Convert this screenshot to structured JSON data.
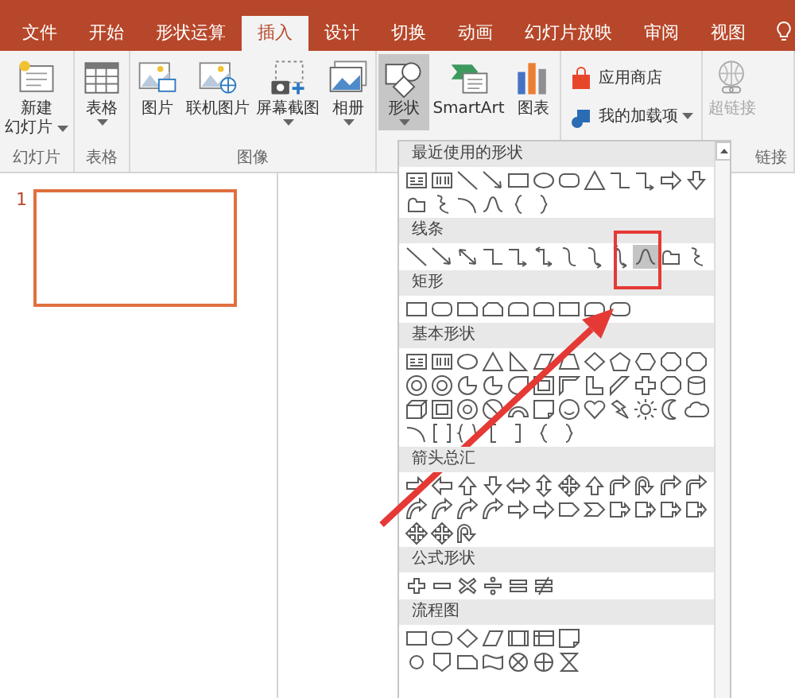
{
  "tabs": [
    {
      "label": "文件",
      "selected": false
    },
    {
      "label": "开始",
      "selected": false
    },
    {
      "label": "形状运算",
      "selected": false
    },
    {
      "label": "插入",
      "selected": true
    },
    {
      "label": "设计",
      "selected": false
    },
    {
      "label": "切换",
      "selected": false
    },
    {
      "label": "动画",
      "selected": false
    },
    {
      "label": "幻灯片放映",
      "selected": false
    },
    {
      "label": "审阅",
      "selected": false
    },
    {
      "label": "视图",
      "selected": false
    }
  ],
  "ribbon": {
    "groups": [
      {
        "label": "幻灯片",
        "buttons": [
          {
            "kind": "large",
            "lines": [
              "新建",
              "幻灯片"
            ],
            "dropdown": true,
            "pressed": false,
            "disabled": false
          }
        ]
      },
      {
        "label": "表格",
        "buttons": [
          {
            "kind": "large",
            "lines": [
              "表格"
            ],
            "dropdown": true,
            "pressed": false,
            "disabled": false
          }
        ]
      },
      {
        "label": "图像",
        "buttons": [
          {
            "kind": "large",
            "lines": [
              "图片"
            ],
            "dropdown": false,
            "pressed": false,
            "disabled": false
          },
          {
            "kind": "large",
            "lines": [
              "联机图片"
            ],
            "dropdown": false,
            "pressed": false,
            "disabled": false
          },
          {
            "kind": "large",
            "lines": [
              "屏幕截图"
            ],
            "dropdown": true,
            "pressed": false,
            "disabled": false
          },
          {
            "kind": "large",
            "lines": [
              "相册"
            ],
            "dropdown": true,
            "pressed": false,
            "disabled": false
          }
        ]
      },
      {
        "buttons": [
          {
            "kind": "large",
            "lines": [
              "形状"
            ],
            "dropdown": true,
            "pressed": true,
            "disabled": false
          },
          {
            "kind": "large",
            "lines": [
              "SmartArt"
            ],
            "dropdown": false,
            "pressed": false,
            "disabled": false
          },
          {
            "kind": "large",
            "lines": [
              "图表"
            ],
            "dropdown": false,
            "pressed": false,
            "disabled": false
          }
        ]
      },
      {
        "buttons": [
          {
            "kind": "small",
            "lines": [
              "应用商店"
            ],
            "dropdown": false
          },
          {
            "kind": "small",
            "lines": [
              "我的加载项"
            ],
            "dropdown": true
          }
        ]
      },
      {
        "label": "链接",
        "buttons": [
          {
            "kind": "large",
            "lines": [
              "超链接"
            ],
            "dropdown": false,
            "pressed": false,
            "disabled": true
          }
        ]
      }
    ]
  },
  "slides": [
    {
      "number": "1",
      "selected": true
    }
  ],
  "shapes_gallery": {
    "sections": [
      {
        "title": "最近使用的形状",
        "rows": [
          [
            {
              "kind": "textbox",
              "selected": false
            },
            {
              "kind": "vtextbox",
              "selected": false
            },
            {
              "kind": "line",
              "selected": false
            },
            {
              "kind": "arrowline",
              "selected": false
            },
            {
              "kind": "rect",
              "selected": false
            },
            {
              "kind": "oval",
              "selected": false
            },
            {
              "kind": "roundrect",
              "selected": false
            },
            {
              "kind": "triangle",
              "selected": false
            },
            {
              "kind": "elbow",
              "selected": false
            },
            {
              "kind": "elbowarrow",
              "selected": false
            },
            {
              "kind": "rarrow",
              "selected": false
            },
            {
              "kind": "darrow",
              "selected": false
            }
          ],
          [
            {
              "kind": "freeform",
              "selected": false
            },
            {
              "kind": "scribble",
              "selected": false
            },
            {
              "kind": "arc",
              "selected": false
            },
            {
              "kind": "curve",
              "selected": false
            },
            {
              "kind": "lbrace",
              "selected": false
            },
            {
              "kind": "rbrace",
              "selected": false
            }
          ]
        ]
      },
      {
        "title": "线条",
        "rows": [
          [
            {
              "kind": "line",
              "selected": false
            },
            {
              "kind": "arrowline",
              "selected": false
            },
            {
              "kind": "dblarrow",
              "selected": false
            },
            {
              "kind": "elbow",
              "selected": false
            },
            {
              "kind": "elbowarrow",
              "selected": false
            },
            {
              "kind": "elbowdbl",
              "selected": false
            },
            {
              "kind": "curveconn",
              "selected": false
            },
            {
              "kind": "curvearrow",
              "selected": false
            },
            {
              "kind": "curvedbl",
              "selected": false
            },
            {
              "kind": "curve",
              "selected": true
            },
            {
              "kind": "freeform",
              "selected": false
            },
            {
              "kind": "scribble",
              "selected": false
            }
          ]
        ]
      },
      {
        "title": "矩形",
        "rows": [
          [
            {
              "kind": "rect",
              "selected": false
            },
            {
              "kind": "roundrect",
              "selected": false
            },
            {
              "kind": "snip",
              "selected": false
            },
            {
              "kind": "snip2",
              "selected": false
            },
            {
              "kind": "roundtop",
              "selected": false
            },
            {
              "kind": "roundtop",
              "selected": false
            },
            {
              "kind": "rect",
              "selected": false
            },
            {
              "kind": "roundtop",
              "selected": false
            },
            {
              "kind": "roundrect",
              "selected": false
            }
          ]
        ]
      },
      {
        "title": "基本形状",
        "rows": [
          [
            {
              "kind": "textbox",
              "selected": false
            },
            {
              "kind": "vtextbox",
              "selected": false
            },
            {
              "kind": "oval",
              "selected": false
            },
            {
              "kind": "triangle",
              "selected": false
            },
            {
              "kind": "rtriangle",
              "selected": false
            },
            {
              "kind": "parallelogram",
              "selected": false
            },
            {
              "kind": "trapezoid",
              "selected": false
            },
            {
              "kind": "diamond",
              "selected": false
            },
            {
              "kind": "pentagon",
              "selected": false
            },
            {
              "kind": "hexagon",
              "selected": false
            },
            {
              "kind": "octagon",
              "selected": false
            },
            {
              "kind": "octagon",
              "selected": false
            }
          ],
          [
            {
              "kind": "target",
              "selected": false
            },
            {
              "kind": "target",
              "selected": false
            },
            {
              "kind": "pie",
              "selected": false
            },
            {
              "kind": "pie",
              "selected": false
            },
            {
              "kind": "teardrop",
              "selected": false
            },
            {
              "kind": "frame",
              "selected": false
            },
            {
              "kind": "halfframe",
              "selected": false
            },
            {
              "kind": "lshape",
              "selected": false
            },
            {
              "kind": "stripe",
              "selected": false
            },
            {
              "kind": "cross",
              "selected": false
            },
            {
              "kind": "octagon",
              "selected": false
            },
            {
              "kind": "can",
              "selected": false
            }
          ],
          [
            {
              "kind": "cube",
              "selected": false
            },
            {
              "kind": "frame",
              "selected": false
            },
            {
              "kind": "donut",
              "selected": false
            },
            {
              "kind": "nosymbol",
              "selected": false
            },
            {
              "kind": "blockarc",
              "selected": false
            },
            {
              "kind": "document",
              "selected": false
            },
            {
              "kind": "smiley",
              "selected": false
            },
            {
              "kind": "heart",
              "selected": false
            },
            {
              "kind": "bolt",
              "selected": false
            },
            {
              "kind": "sun",
              "selected": false
            },
            {
              "kind": "moon",
              "selected": false
            },
            {
              "kind": "cloud",
              "selected": false
            }
          ],
          [
            {
              "kind": "arc",
              "selected": false
            },
            {
              "kind": "bracketpair",
              "selected": false
            },
            {
              "kind": "bracepair",
              "selected": false
            },
            {
              "kind": "lbracket",
              "selected": false
            },
            {
              "kind": "rbracket",
              "selected": false
            },
            {
              "kind": "lbrace",
              "selected": false
            },
            {
              "kind": "rbrace",
              "selected": false
            }
          ]
        ]
      },
      {
        "title": "箭头总汇",
        "rows": [
          [
            {
              "kind": "rarrow",
              "selected": false
            },
            {
              "kind": "larrow",
              "selected": false
            },
            {
              "kind": "uarrow",
              "selected": false
            },
            {
              "kind": "darrow",
              "selected": false
            },
            {
              "kind": "lrarrow",
              "selected": false
            },
            {
              "kind": "udarrow",
              "selected": false
            },
            {
              "kind": "quadarrow",
              "selected": false
            },
            {
              "kind": "uarrow",
              "selected": false
            },
            {
              "kind": "bentarrow",
              "selected": false
            },
            {
              "kind": "uturn",
              "selected": false
            },
            {
              "kind": "bentarrow",
              "selected": false
            },
            {
              "kind": "bentarrow",
              "selected": false
            }
          ],
          [
            {
              "kind": "curvedarrow",
              "selected": false
            },
            {
              "kind": "curvedarrow",
              "selected": false
            },
            {
              "kind": "curvedarrow",
              "selected": false
            },
            {
              "kind": "curvedarrow",
              "selected": false
            },
            {
              "kind": "rarrow",
              "selected": false
            },
            {
              "kind": "rarrow",
              "selected": false
            },
            {
              "kind": "homeplate",
              "selected": false
            },
            {
              "kind": "chevron",
              "selected": false
            },
            {
              "kind": "callout",
              "selected": false
            },
            {
              "kind": "callout",
              "selected": false
            },
            {
              "kind": "callout",
              "selected": false
            },
            {
              "kind": "callout",
              "selected": false
            }
          ],
          [
            {
              "kind": "quadarrow",
              "selected": false
            },
            {
              "kind": "quadarrow",
              "selected": false
            },
            {
              "kind": "uturn",
              "selected": false
            }
          ]
        ]
      },
      {
        "title": "公式形状",
        "rows": [
          [
            {
              "kind": "plus",
              "selected": false
            },
            {
              "kind": "minus",
              "selected": false
            },
            {
              "kind": "times",
              "selected": false
            },
            {
              "kind": "divide",
              "selected": false
            },
            {
              "kind": "equal",
              "selected": false
            },
            {
              "kind": "notequal",
              "selected": false
            }
          ]
        ]
      },
      {
        "title": "流程图",
        "rows": [
          [
            {
              "kind": "rect",
              "selected": false
            },
            {
              "kind": "roundrect",
              "selected": false
            },
            {
              "kind": "diamond",
              "selected": false
            },
            {
              "kind": "parallelogram",
              "selected": false
            },
            {
              "kind": "predefined",
              "selected": false
            },
            {
              "kind": "internal",
              "selected": false
            },
            {
              "kind": "document",
              "selected": false
            }
          ],
          [
            {
              "kind": "smallcircle",
              "selected": false
            },
            {
              "kind": "offpage",
              "selected": false
            },
            {
              "kind": "snip",
              "selected": false
            },
            {
              "kind": "tape",
              "selected": false
            },
            {
              "kind": "sumjunction",
              "selected": false
            },
            {
              "kind": "orjunction",
              "selected": false
            },
            {
              "kind": "collate",
              "selected": false
            }
          ]
        ]
      }
    ]
  }
}
